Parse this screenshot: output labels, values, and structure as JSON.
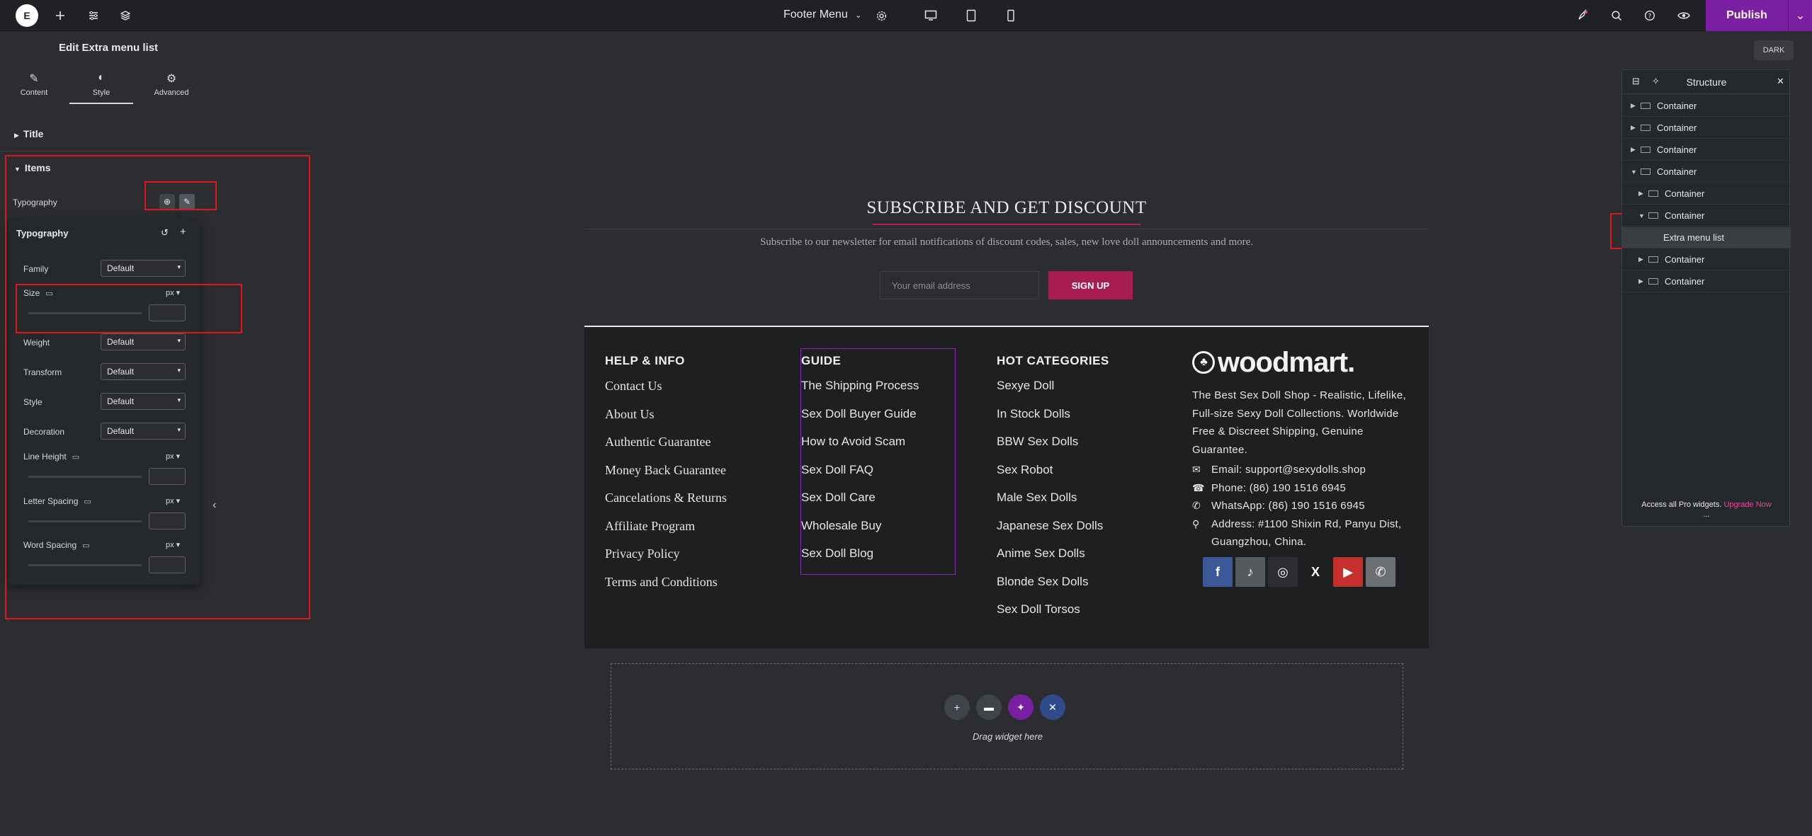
{
  "topbar": {
    "document_title": "Footer Menu",
    "publish_label": "Publish"
  },
  "panel": {
    "title": "Edit Extra menu list",
    "tabs": [
      {
        "label": "Content",
        "icon": "pencil-icon"
      },
      {
        "label": "Style",
        "icon": "half-circle-icon"
      },
      {
        "label": "Advanced",
        "icon": "gear-icon"
      }
    ],
    "sections": {
      "title": "Title",
      "items": "Items"
    },
    "typography_label": "Typography",
    "popover": {
      "title": "Typography",
      "family_label": "Family",
      "family_value": "Default",
      "size_label": "Size",
      "size_unit": "px",
      "weight_label": "Weight",
      "weight_value": "Default",
      "transform_label": "Transform",
      "transform_value": "Default",
      "style_label": "Style",
      "style_value": "Default",
      "decoration_label": "Decoration",
      "decoration_value": "Default",
      "line_height_label": "Line Height",
      "line_height_unit": "px",
      "letter_spacing_label": "Letter Spacing",
      "letter_spacing_unit": "px",
      "word_spacing_label": "Word Spacing",
      "word_spacing_unit": "px"
    }
  },
  "canvas": {
    "dark_label": "DARK",
    "subscribe": {
      "title": "SUBSCRIBE AND GET DISCOUNT",
      "text": "Subscribe to our newsletter for email notifications of discount codes, sales, new love doll announcements and more.",
      "email_placeholder": "Your email address",
      "button": "SIGN UP"
    },
    "footer": {
      "col1": {
        "heading": "HELP & INFO",
        "items": [
          "Contact Us",
          "About Us",
          "Authentic Guarantee",
          "Money Back Guarantee",
          "Cancelations & Returns",
          "Affiliate Program",
          "Privacy Policy",
          "Terms and Conditions"
        ]
      },
      "col2": {
        "heading": "GUIDE",
        "items": [
          "The Shipping Process",
          "Sex Doll Buyer Guide",
          "How to Avoid Scam",
          "Sex Doll FAQ",
          "Sex Doll Care",
          "Wholesale Buy",
          "Sex Doll Blog"
        ]
      },
      "col3": {
        "heading": "HOT CATEGORIES",
        "items": [
          "Sexye Doll",
          "In Stock Dolls",
          "BBW Sex Dolls",
          "Sex Robot",
          "Male Sex Dolls",
          "Japanese Sex Dolls",
          "Anime Sex Dolls",
          "Blonde Sex Dolls",
          "Sex Doll Torsos"
        ]
      },
      "brand": {
        "logo_text": "woodmart.",
        "description": "The Best Sex Doll Shop - Realistic, Lifelike, Full-size Sexy Doll Collections. Worldwide Free & Discreet Shipping, Genuine Guarantee.",
        "email": "Email: support@sexydolls.shop",
        "phone": "Phone: (86) 190 1516 6945",
        "whatsapp": "WhatsApp: (86) 190 1516 6945",
        "address": "Address: #1100 Shixin Rd, Panyu Dist, Guangzhou, China."
      },
      "social": [
        {
          "icon": "facebook-icon",
          "glyph": "f",
          "color": "#3b5998"
        },
        {
          "icon": "tiktok-icon",
          "glyph": "♪",
          "color": "#555a5f"
        },
        {
          "icon": "instagram-icon",
          "glyph": "◎",
          "color": "#2b2d31"
        },
        {
          "icon": "x-icon",
          "glyph": "X",
          "color": "#1e1f21"
        },
        {
          "icon": "youtube-icon",
          "glyph": "▶",
          "color": "#c4302b"
        },
        {
          "icon": "whatsapp-icon",
          "glyph": "✆",
          "color": "#6b6f74"
        }
      ]
    },
    "drop_zone_text": "Drag widget here"
  },
  "structure": {
    "title": "Structure",
    "rows": [
      {
        "label": "Container",
        "depth": 0,
        "state": "collapsed"
      },
      {
        "label": "Container",
        "depth": 0,
        "state": "collapsed"
      },
      {
        "label": "Container",
        "depth": 0,
        "state": "collapsed"
      },
      {
        "label": "Container",
        "depth": 0,
        "state": "expanded"
      },
      {
        "label": "Container",
        "depth": 1,
        "state": "collapsed"
      },
      {
        "label": "Container",
        "depth": 1,
        "state": "expanded"
      },
      {
        "label": "Extra menu list",
        "depth": 2,
        "state": "leaf"
      },
      {
        "label": "Container",
        "depth": 1,
        "state": "collapsed"
      },
      {
        "label": "Container",
        "depth": 1,
        "state": "collapsed"
      }
    ],
    "footer_text": "Access all Pro widgets.",
    "upgrade_label": "Upgrade Now",
    "more_label": "..."
  }
}
